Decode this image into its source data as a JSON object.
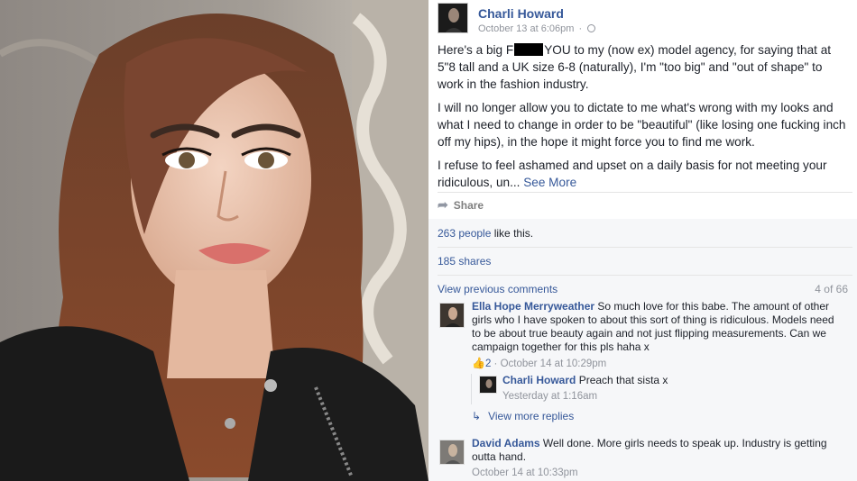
{
  "post": {
    "author": "Charli Howard",
    "timestamp": "October 13 at 6:06pm",
    "p1_a": "Here's a big F",
    "p1_b": "YOU to my (now ex) model agency, for saying that at 5\"8 tall and a UK size 6-8 (naturally), I'm \"too big\" and \"out of shape\" to work in the fashion industry.",
    "p2": "I will no longer allow you to dictate to me what's wrong with my looks and what I need to change in order to be \"beautiful\" (like losing one fucking inch off my hips), in the hope it might force you to find me work.",
    "p3": "I refuse to feel ashamed and upset on a daily basis for not meeting your ridiculous, un...",
    "see_more": "See More"
  },
  "actions": {
    "share": "Share"
  },
  "stats": {
    "likes_count": "263 people",
    "likes_suffix": " like this.",
    "shares": "185 shares"
  },
  "comments_header": {
    "view_previous": "View previous comments",
    "count": "4 of 66"
  },
  "comments": [
    {
      "author": "Ella Hope Merryweather",
      "text": " So much love for this babe. The amount of other girls who I have spoken to about this sort of thing is ridiculous. Models need to be about true beauty again and not just flipping measurements. Can we campaign together for this pls haha x",
      "likes": "2",
      "time": " · October 14 at 10:29pm"
    },
    {
      "author": "David Adams",
      "text": " Well done. More girls needs to speak up. Industry is getting outta hand.",
      "time": "October 14 at 10:33pm"
    }
  ],
  "reply": {
    "author": "Charli Howard",
    "text": " Preach that sista x",
    "time": "Yesterday at 1:16am"
  },
  "view_more_replies": "View more replies",
  "icons": {
    "globe": "globe-icon",
    "share": "share-arrow-icon",
    "like": "thumbs-up-icon",
    "reply": "reply-arrow-icon"
  },
  "colors": {
    "link": "#365899",
    "meta": "#90949c",
    "text": "#1d2129",
    "panel_gray": "#f6f7f9"
  }
}
